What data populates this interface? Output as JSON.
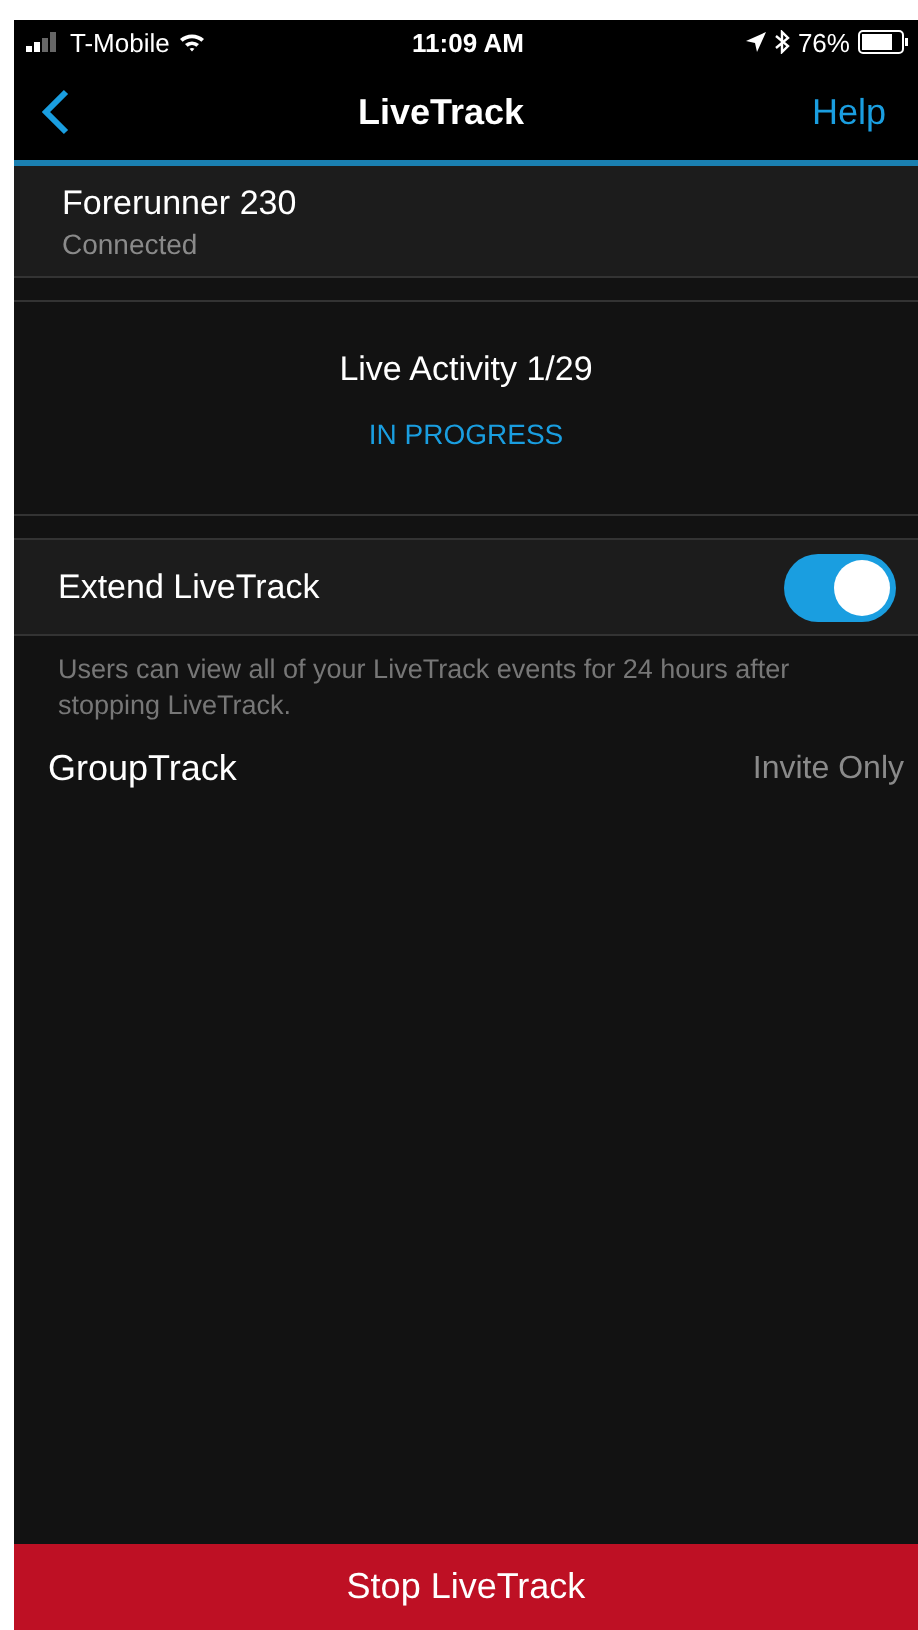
{
  "status_bar": {
    "carrier": "T-Mobile",
    "time": "11:09 AM",
    "battery": "76%"
  },
  "nav": {
    "title": "LiveTrack",
    "action": "Help"
  },
  "device": {
    "name": "Forerunner 230",
    "status": "Connected"
  },
  "activity": {
    "title": "Live Activity 1/29",
    "status": "IN PROGRESS"
  },
  "extend": {
    "label": "Extend LiveTrack",
    "on": true,
    "note": "Users can view all of your LiveTrack events for 24 hours after stopping LiveTrack."
  },
  "group_track": {
    "label": "GroupTrack",
    "value": "Invite Only"
  },
  "stop_button": "Stop LiveTrack"
}
